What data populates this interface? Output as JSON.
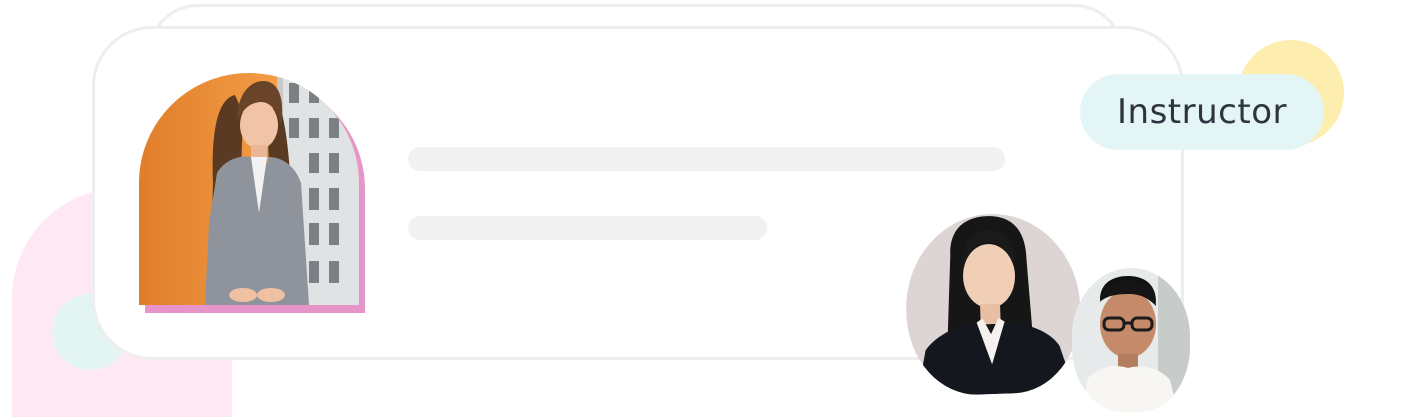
{
  "badge": {
    "label": "Instructor"
  },
  "colors": {
    "card_border": "#eeeeee",
    "placeholder": "#f1f1f1",
    "pink_blob": "#fde8f3",
    "mint_blob": "#e3f5f3",
    "yellow_blob": "#fdeeb0",
    "photo_accent": "#e795c8",
    "badge_bg": "#e4f5f6",
    "badge_text": "#2f3540"
  },
  "images": {
    "main_photo": "portrait-woman-gray-blazer",
    "avatar_1": "portrait-woman-black-suit",
    "avatar_2": "portrait-woman-glasses"
  }
}
